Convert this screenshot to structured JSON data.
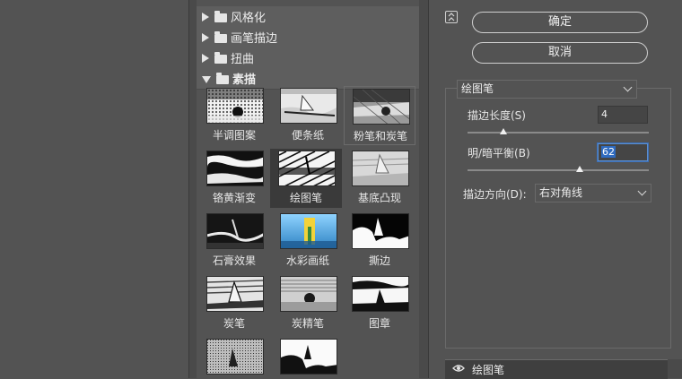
{
  "gallery": {
    "categories": [
      {
        "label": "风格化",
        "expanded": false
      },
      {
        "label": "画笔描边",
        "expanded": false
      },
      {
        "label": "扭曲",
        "expanded": false
      },
      {
        "label": "素描",
        "expanded": true
      }
    ],
    "thumbs": [
      {
        "label": "半调图案"
      },
      {
        "label": "便条纸"
      },
      {
        "label": "粉笔和炭笔"
      },
      {
        "label": "铬黄渐变"
      },
      {
        "label": "绘图笔"
      },
      {
        "label": "基底凸现"
      },
      {
        "label": "石膏效果"
      },
      {
        "label": "水彩画纸"
      },
      {
        "label": "撕边"
      },
      {
        "label": "炭笔"
      },
      {
        "label": "炭精笔"
      },
      {
        "label": "图章"
      },
      {
        "label": ""
      },
      {
        "label": ""
      }
    ],
    "selected": "绘图笔"
  },
  "buttons": {
    "ok": "确定",
    "cancel": "取消"
  },
  "filter": {
    "selected": "绘图笔"
  },
  "params": {
    "stroke_length": {
      "label": "描边长度(S)",
      "value": "4",
      "level_fraction": 0.2
    },
    "light_dark_balance": {
      "label": "明/暗平衡(B)",
      "value": "62",
      "level_fraction": 0.62
    },
    "stroke_direction": {
      "label": "描边方向(D):",
      "value": "右对角线"
    }
  },
  "layers": [
    {
      "name": "绘图笔",
      "visible": true
    }
  ],
  "colors": {
    "background": "#535353",
    "selection": "#3a3a3a",
    "focus": "#3b6fb6"
  }
}
